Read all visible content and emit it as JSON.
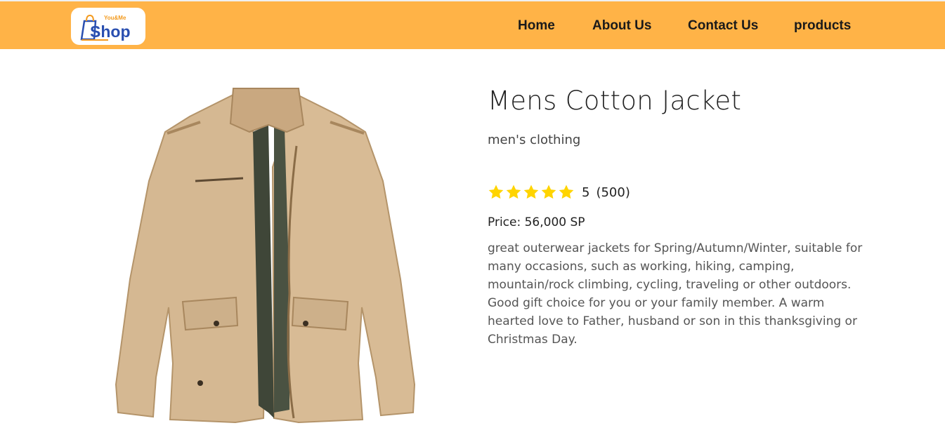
{
  "header": {
    "logo": {
      "top_text": "You&Me",
      "main_text": "Shop"
    },
    "nav": [
      {
        "label": "Home"
      },
      {
        "label": "About Us"
      },
      {
        "label": "Contact Us"
      },
      {
        "label": "products"
      }
    ],
    "background_color": "#ffb347"
  },
  "product": {
    "title": "Mens Cotton Jacket",
    "category": "men's clothing",
    "rating": {
      "stars": 5,
      "value": "5",
      "count": "(500)",
      "star_color": "#ffd400"
    },
    "price": "Price: 56,000 SP",
    "description": "great outerwear jackets for Spring/Autumn/Winter, suitable for many occasions, such as working, hiking, camping, mountain/rock climbing, cycling, traveling or other outdoors. Good gift choice for you or your family member. A warm hearted love to Father, husband or son in this thanksgiving or Christmas Day.",
    "image_icon": "jacket-image"
  }
}
